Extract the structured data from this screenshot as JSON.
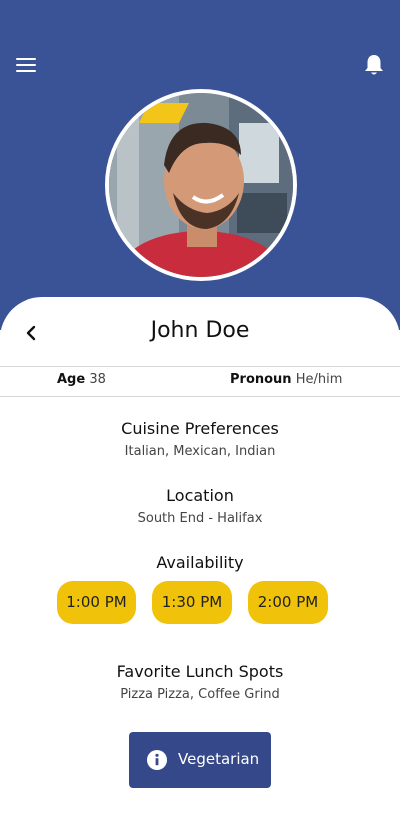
{
  "profile": {
    "name": "John Doe",
    "age_label": "Age",
    "age_value": "38",
    "pronoun_label": "Pronoun",
    "pronoun_value": "He/him"
  },
  "sections": {
    "cuisine": {
      "title": "Cuisine Preferences",
      "value": "Italian, Mexican, Indian"
    },
    "location": {
      "title": "Location",
      "value": "South End - Halifax"
    },
    "availability": {
      "title": "Availability",
      "slots": [
        "1:00 PM",
        "1:30 PM",
        "2:00 PM"
      ]
    },
    "lunch_spots": {
      "title": "Favorite Lunch Spots",
      "value": "Pizza Pizza, Coffee Grind"
    }
  },
  "dietary_button": {
    "label": "Vegetarian",
    "icon": "info-icon"
  },
  "icons": {
    "menu": "hamburger-menu-icon",
    "notifications": "bell-icon",
    "back": "chevron-left-icon"
  },
  "colors": {
    "header_bg": "#3a5396",
    "slot_bg": "#f0c20a",
    "button_bg": "#35498a"
  }
}
